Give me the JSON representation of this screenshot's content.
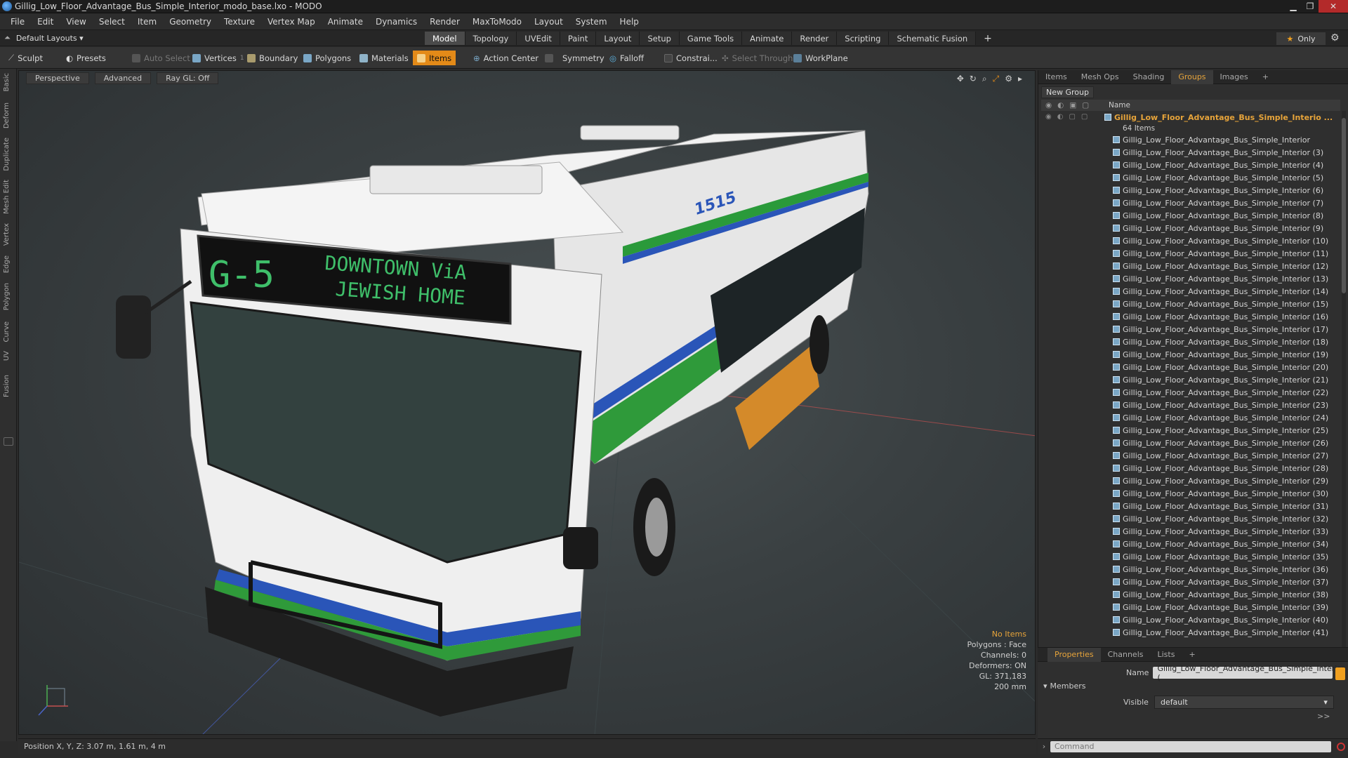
{
  "window": {
    "title": "Gillig_Low_Floor_Advantage_Bus_Simple_Interior_modo_base.lxo - MODO"
  },
  "menu": [
    "File",
    "Edit",
    "View",
    "Select",
    "Item",
    "Geometry",
    "Texture",
    "Vertex Map",
    "Animate",
    "Dynamics",
    "Render",
    "MaxToModo",
    "Layout",
    "System",
    "Help"
  ],
  "layout": {
    "dropdown": "Default Layouts ▾",
    "tabs": [
      "Model",
      "Topology",
      "UVEdit",
      "Paint",
      "Layout",
      "Setup",
      "Game Tools",
      "Animate",
      "Render",
      "Scripting",
      "Schematic Fusion"
    ],
    "active_tab": "Model",
    "only_label": "Only"
  },
  "toolbar": {
    "sculpt": "Sculpt",
    "presets": "Presets",
    "auto_select": "Auto Select",
    "vertices": "Vertices",
    "vertices_count": "1",
    "boundary": "Boundary",
    "polygons": "Polygons",
    "materials": "Materials",
    "items": "Items",
    "action_center": "Action Center",
    "symmetry": "Symmetry",
    "falloff": "Falloff",
    "constraints": "Constrai...",
    "select_through": "Select Through",
    "workplane": "WorkPlane"
  },
  "left_strip": [
    "Basic",
    "Deform",
    "Duplicate",
    "Mesh Edit",
    "Vertex",
    "Edge",
    "Polygon",
    "Curve",
    "UV",
    "Fusion"
  ],
  "viewport": {
    "view_mode": "Perspective",
    "shading": "Advanced",
    "raygl": "Ray GL: Off",
    "info": {
      "items": "No Items",
      "polygons": "Polygons : Face",
      "channels": "Channels: 0",
      "deformers": "Deformers: ON",
      "gl": "GL: 371,183",
      "scale": "200 mm"
    },
    "sign_route": "G-5",
    "sign_line1": "DOWNTOWN ViA",
    "sign_line2": "JEWISH HOME",
    "bus_number": "1515"
  },
  "status": {
    "position": "Position X, Y, Z:  3.07 m, 1.61 m, 4 m"
  },
  "right_panel": {
    "tabs": [
      "Items",
      "Mesh Ops",
      "Shading",
      "Groups",
      "Images",
      "+"
    ],
    "active_tab": "Groups",
    "new_group": "New Group",
    "col_name": "Name",
    "root_group": "Gillig_Low_Floor_Advantage_Bus_Simple_Interio ...",
    "root_count": "64 Items",
    "items": [
      "Gillig_Low_Floor_Advantage_Bus_Simple_Interior",
      "Gillig_Low_Floor_Advantage_Bus_Simple_Interior (3)",
      "Gillig_Low_Floor_Advantage_Bus_Simple_Interior (4)",
      "Gillig_Low_Floor_Advantage_Bus_Simple_Interior (5)",
      "Gillig_Low_Floor_Advantage_Bus_Simple_Interior (6)",
      "Gillig_Low_Floor_Advantage_Bus_Simple_Interior (7)",
      "Gillig_Low_Floor_Advantage_Bus_Simple_Interior (8)",
      "Gillig_Low_Floor_Advantage_Bus_Simple_Interior (9)",
      "Gillig_Low_Floor_Advantage_Bus_Simple_Interior (10)",
      "Gillig_Low_Floor_Advantage_Bus_Simple_Interior (11)",
      "Gillig_Low_Floor_Advantage_Bus_Simple_Interior (12)",
      "Gillig_Low_Floor_Advantage_Bus_Simple_Interior (13)",
      "Gillig_Low_Floor_Advantage_Bus_Simple_Interior (14)",
      "Gillig_Low_Floor_Advantage_Bus_Simple_Interior (15)",
      "Gillig_Low_Floor_Advantage_Bus_Simple_Interior (16)",
      "Gillig_Low_Floor_Advantage_Bus_Simple_Interior (17)",
      "Gillig_Low_Floor_Advantage_Bus_Simple_Interior (18)",
      "Gillig_Low_Floor_Advantage_Bus_Simple_Interior (19)",
      "Gillig_Low_Floor_Advantage_Bus_Simple_Interior (20)",
      "Gillig_Low_Floor_Advantage_Bus_Simple_Interior (21)",
      "Gillig_Low_Floor_Advantage_Bus_Simple_Interior (22)",
      "Gillig_Low_Floor_Advantage_Bus_Simple_Interior (23)",
      "Gillig_Low_Floor_Advantage_Bus_Simple_Interior (24)",
      "Gillig_Low_Floor_Advantage_Bus_Simple_Interior (25)",
      "Gillig_Low_Floor_Advantage_Bus_Simple_Interior (26)",
      "Gillig_Low_Floor_Advantage_Bus_Simple_Interior (27)",
      "Gillig_Low_Floor_Advantage_Bus_Simple_Interior (28)",
      "Gillig_Low_Floor_Advantage_Bus_Simple_Interior (29)",
      "Gillig_Low_Floor_Advantage_Bus_Simple_Interior (30)",
      "Gillig_Low_Floor_Advantage_Bus_Simple_Interior (31)",
      "Gillig_Low_Floor_Advantage_Bus_Simple_Interior (32)",
      "Gillig_Low_Floor_Advantage_Bus_Simple_Interior (33)",
      "Gillig_Low_Floor_Advantage_Bus_Simple_Interior (34)",
      "Gillig_Low_Floor_Advantage_Bus_Simple_Interior (35)",
      "Gillig_Low_Floor_Advantage_Bus_Simple_Interior (36)",
      "Gillig_Low_Floor_Advantage_Bus_Simple_Interior (37)",
      "Gillig_Low_Floor_Advantage_Bus_Simple_Interior (38)",
      "Gillig_Low_Floor_Advantage_Bus_Simple_Interior (39)",
      "Gillig_Low_Floor_Advantage_Bus_Simple_Interior (40)",
      "Gillig_Low_Floor_Advantage_Bus_Simple_Interior (41)"
    ]
  },
  "properties": {
    "tabs": [
      "Properties",
      "Channels",
      "Lists",
      "+"
    ],
    "active_tab": "Properties",
    "name_label": "Name",
    "name_value": "Gillig_Low_Floor_Advantage_Bus_Simple_Interior (",
    "members_label": "Members",
    "visible_label": "Visible",
    "visible_value": "default",
    "more": ">>"
  },
  "command": {
    "placeholder": "Command"
  },
  "colors": {
    "accent": "#e38a18",
    "highlight_text": "#e7a43a",
    "viewport_bg": "#3a4042"
  }
}
